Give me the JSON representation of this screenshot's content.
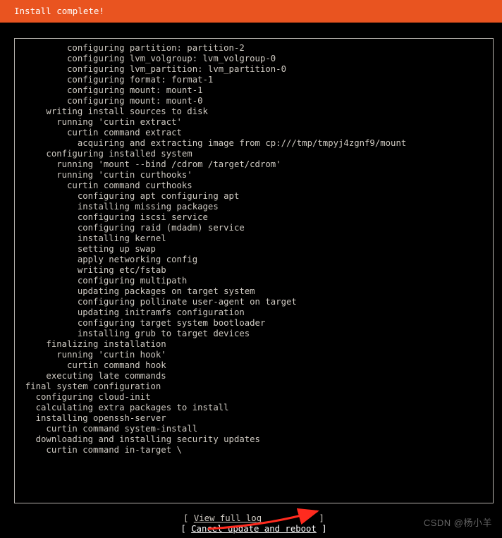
{
  "header": {
    "title": "Install complete!"
  },
  "log": {
    "lines": [
      "          configuring partition: partition-2",
      "          configuring lvm_volgroup: lvm_volgroup-0",
      "          configuring lvm_partition: lvm_partition-0",
      "          configuring format: format-1",
      "          configuring mount: mount-1",
      "          configuring mount: mount-0",
      "      writing install sources to disk",
      "        running 'curtin extract'",
      "          curtin command extract",
      "            acquiring and extracting image from cp:///tmp/tmpyj4zgnf9/mount",
      "      configuring installed system",
      "        running 'mount --bind /cdrom /target/cdrom'",
      "        running 'curtin curthooks'",
      "          curtin command curthooks",
      "            configuring apt configuring apt",
      "            installing missing packages",
      "            configuring iscsi service",
      "            configuring raid (mdadm) service",
      "            installing kernel",
      "            setting up swap",
      "            apply networking config",
      "            writing etc/fstab",
      "            configuring multipath",
      "            updating packages on target system",
      "            configuring pollinate user-agent on target",
      "            updating initramfs configuration",
      "            configuring target system bootloader",
      "            installing grub to target devices",
      "      finalizing installation",
      "        running 'curtin hook'",
      "          curtin command hook",
      "      executing late commands",
      "  final system configuration",
      "    configuring cloud-init",
      "    calculating extra packages to install",
      "    installing openssh-server",
      "      curtin command system-install",
      "    downloading and installing security updates",
      "      curtin command in-target \\"
    ]
  },
  "buttons": {
    "view_log": {
      "label": "View full log",
      "pad_left": " ",
      "pad_right": "           "
    },
    "cancel": {
      "label": "Cancel update and reboot",
      "pad_left": " ",
      "pad_right": " "
    }
  },
  "watermark": "CSDN @杨小羊"
}
